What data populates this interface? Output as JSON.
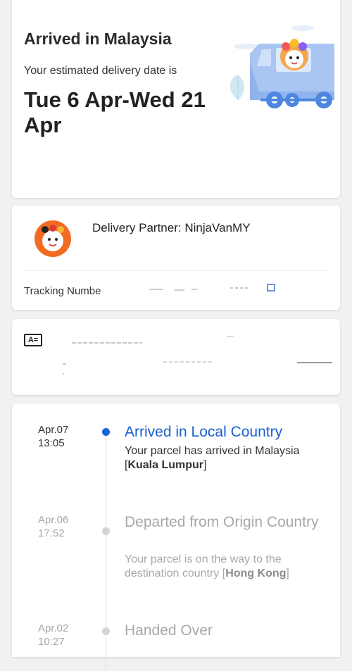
{
  "status": {
    "title": "Arrived in Malaysia",
    "eta_label": "Your estimated delivery date is",
    "eta_dates": "Tue 6 Apr-Wed 21 Apr"
  },
  "partner": {
    "label": "Delivery Partner: NinjaVanMY",
    "tracking_label": "Tracking Numbe"
  },
  "address": {
    "icon_text": "A="
  },
  "timeline": [
    {
      "date": "Apr.07",
      "time": "13:05",
      "title": "Arrived in Local Country",
      "desc": "Your parcel has arrived in Malaysia ",
      "location": "Kuala Lumpur",
      "active": true
    },
    {
      "date": "Apr.06",
      "time": "17:52",
      "title": "Departed from Origin Country",
      "desc": "Your parcel is on the way to the destination country ",
      "location": "Hong Kong",
      "active": false
    },
    {
      "date": "Apr.02",
      "time": "10:27",
      "title": "Handed Over",
      "desc": "",
      "location": "",
      "active": false
    }
  ],
  "colors": {
    "accent": "#1a5fd0",
    "muted": "#a8a8a8",
    "background": "#f1f1f1"
  },
  "icons": {
    "van": "delivery-van-illustration",
    "partner_logo": "ninjavan-mascot-logo",
    "address": "id-card-icon",
    "copy": "copy-icon"
  }
}
